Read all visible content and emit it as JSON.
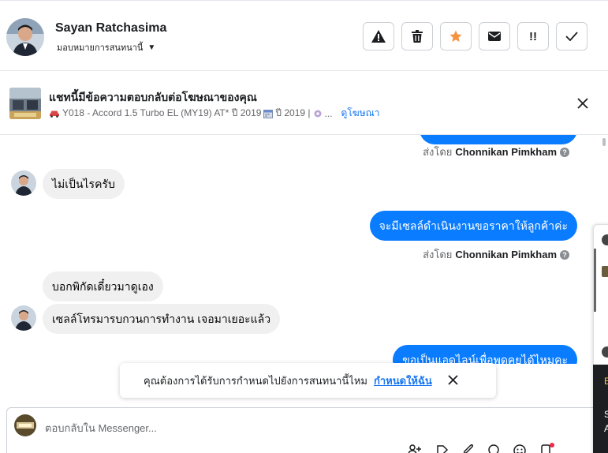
{
  "header": {
    "user_name": "Sayan Ratchasima",
    "assign_label": "มอบหมายการสนทนานี้",
    "actions": [
      {
        "name": "report-button",
        "icon": "warning-icon"
      },
      {
        "name": "delete-button",
        "icon": "trash-icon"
      },
      {
        "name": "star-button",
        "icon": "star-icon"
      },
      {
        "name": "mark-unread-button",
        "icon": "envelope-icon"
      },
      {
        "name": "follow-up-button",
        "icon": "important-icon"
      },
      {
        "name": "mark-done-button",
        "icon": "check-icon"
      }
    ]
  },
  "ad_banner": {
    "title": "แชทนี้มีข้อความตอบกลับต่อโฆษณาของคุณ",
    "listing_text": "Y018 - Accord 1.5 Turbo EL (MY19) AT* ปี 2019",
    "year_text": "ปี 2019 |",
    "ellipsis": "...",
    "view_ad_link": "ดูโฆษณา"
  },
  "messages": [
    {
      "kind": "sent_by",
      "label": "ส่งโดย",
      "agent": "Chonnikan Pimkham"
    },
    {
      "kind": "incoming",
      "text": "ไม่เป็นไรครับ"
    },
    {
      "kind": "outgoing",
      "text": "จะมีเซลล์ดำเนินงานขอราคาให้ลูกค้าค่ะ"
    },
    {
      "kind": "sent_by",
      "label": "ส่งโดย",
      "agent": "Chonnikan Pimkham"
    },
    {
      "kind": "incoming",
      "text": "บอกพิกัดเดี๋ยวมาดูเอง"
    },
    {
      "kind": "incoming",
      "text": "เซลล์โทรมารบกวนการทำงาน เจอมาเยอะแล้ว"
    },
    {
      "kind": "outgoing",
      "text": "ขอเป็นแอดไลน์เพื่อพูดคุยได้ไหมคะ"
    }
  ],
  "toast": {
    "text": "คุณต้องการได้รับการกำหนดไปยังการสนทนานี้ไหม",
    "action": "กำหนดให้ฉัน"
  },
  "composer": {
    "placeholder": "ตอบกลับใน Messenger..."
  },
  "side_panel": {
    "letter_1": "E",
    "letter_2": "S",
    "letter_3": "A"
  },
  "colors": {
    "accent": "#0a7cff",
    "link": "#1876f2",
    "star": "#f5923e"
  }
}
